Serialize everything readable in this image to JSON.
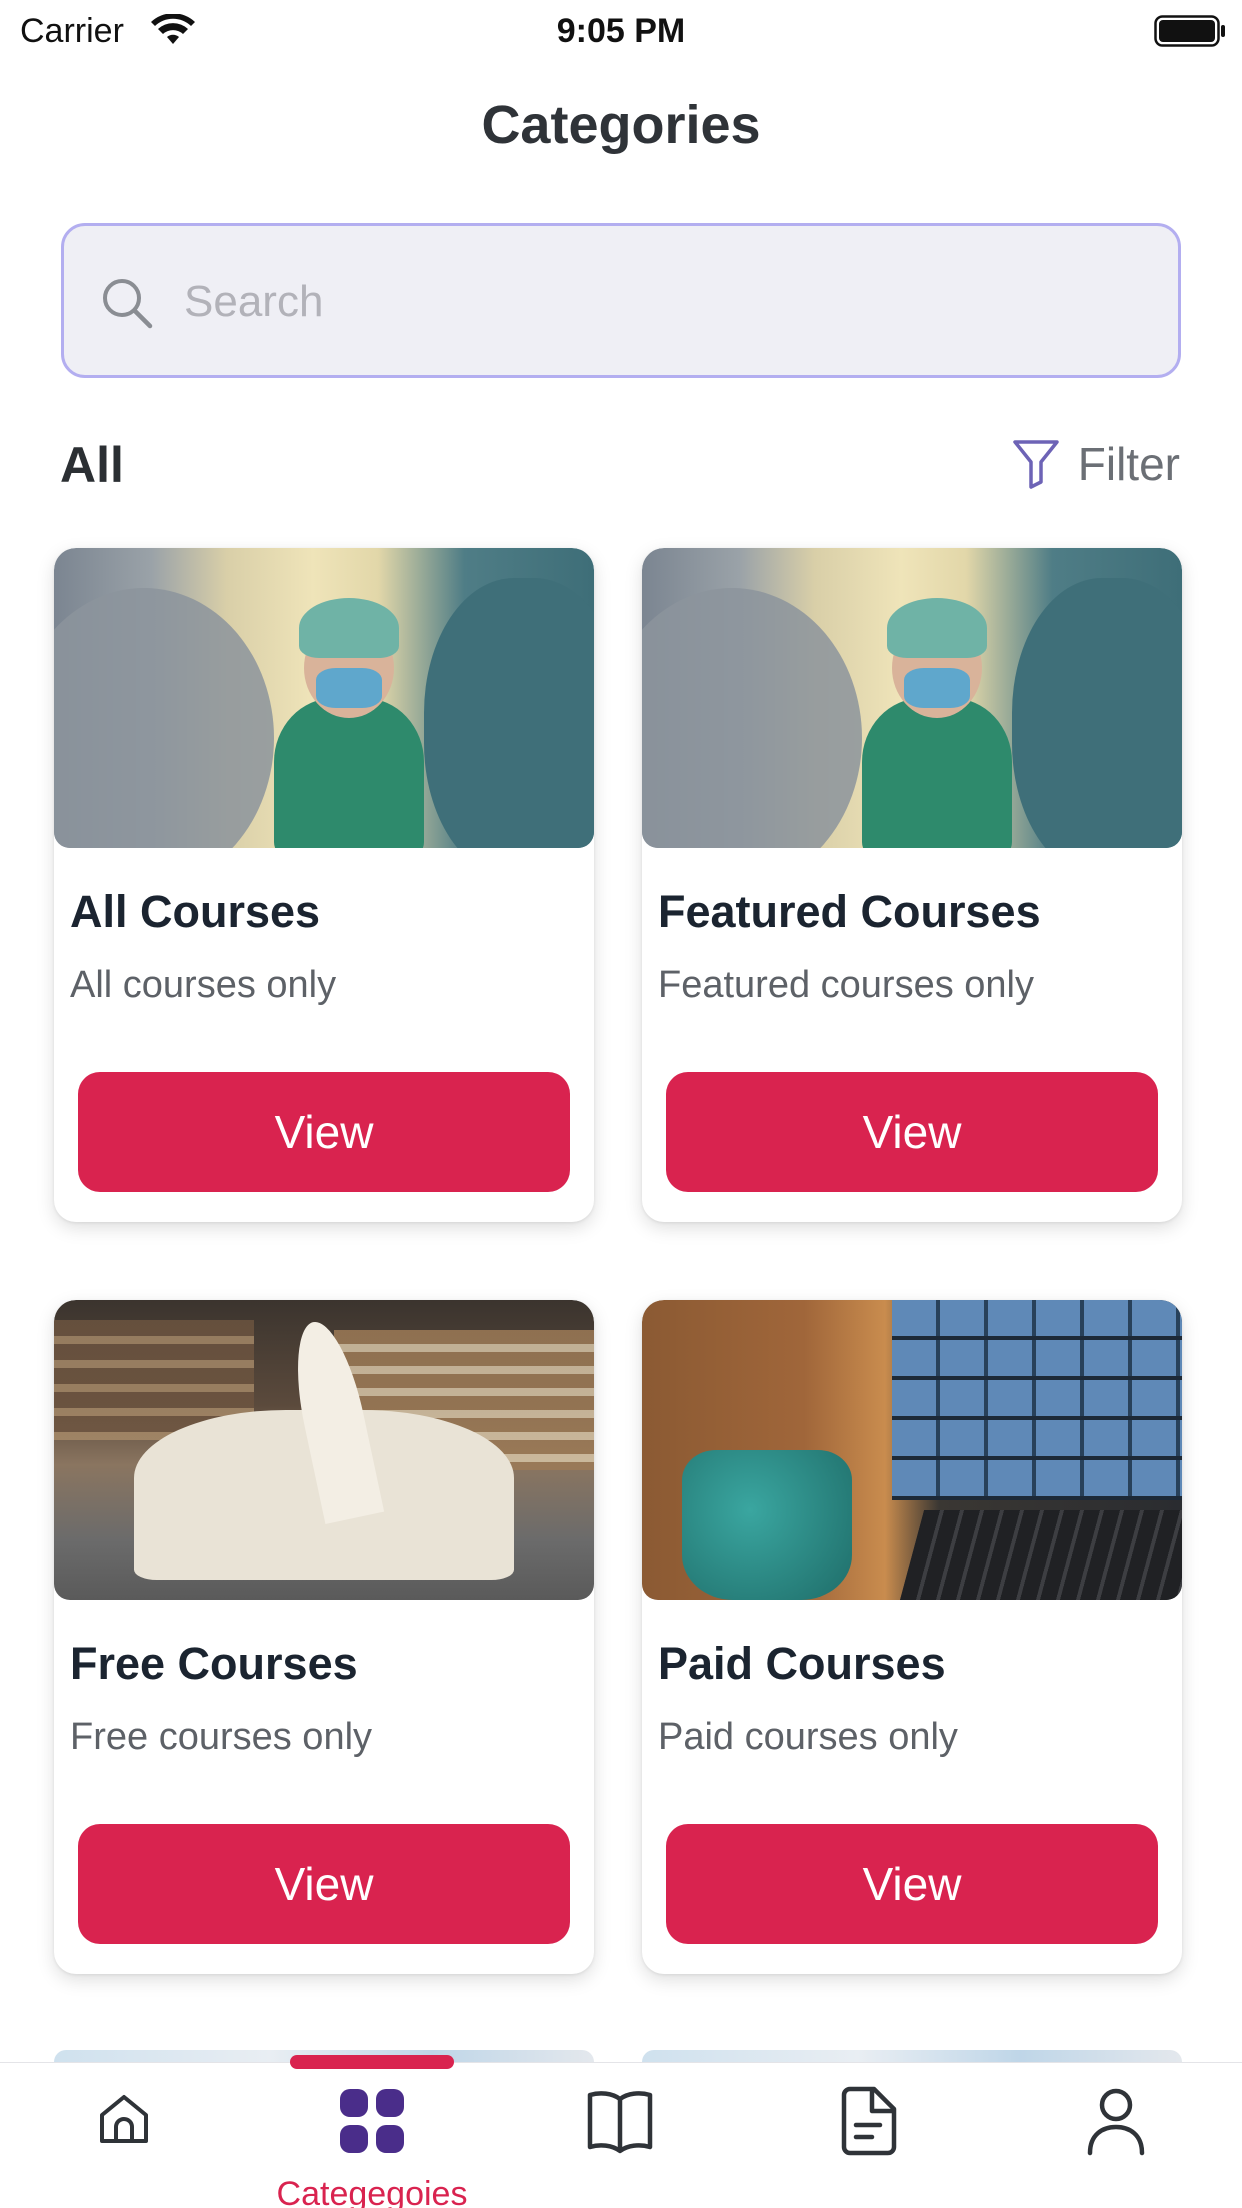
{
  "status_bar": {
    "carrier": "Carrier",
    "time": "9:05 PM",
    "wifi_icon": "wifi-icon",
    "battery_icon": "battery-full-icon"
  },
  "header": {
    "title": "Categories"
  },
  "search": {
    "placeholder": "Search",
    "value": "",
    "icon": "search-icon"
  },
  "section": {
    "label": "All",
    "filter_label": "Filter",
    "filter_icon": "funnel-icon"
  },
  "cards": [
    {
      "title": "All Courses",
      "description": "All courses only",
      "button_label": "View",
      "image": "medical-staff-photo"
    },
    {
      "title": "Featured Courses",
      "description": "Featured courses only",
      "button_label": "View",
      "image": "medical-staff-photo"
    },
    {
      "title": "Free Courses",
      "description": "Free courses only",
      "button_label": "View",
      "image": "open-book-photo"
    },
    {
      "title": "Paid Courses",
      "description": "Paid courses only",
      "button_label": "View",
      "image": "laptop-video-call-photo"
    }
  ],
  "tabbar": {
    "active_index": 1,
    "tabs": [
      {
        "label": "",
        "icon": "home-icon"
      },
      {
        "label": "Categegoies",
        "icon": "categories-grid-icon"
      },
      {
        "label": "",
        "icon": "book-icon"
      },
      {
        "label": "",
        "icon": "document-icon"
      },
      {
        "label": "",
        "icon": "profile-icon"
      }
    ]
  },
  "colors": {
    "accent": "#d9234f",
    "active_icon": "#4a2d8a",
    "search_border": "#b3aef0",
    "search_bg": "#efeff5",
    "filter_icon": "#6d63b6"
  }
}
